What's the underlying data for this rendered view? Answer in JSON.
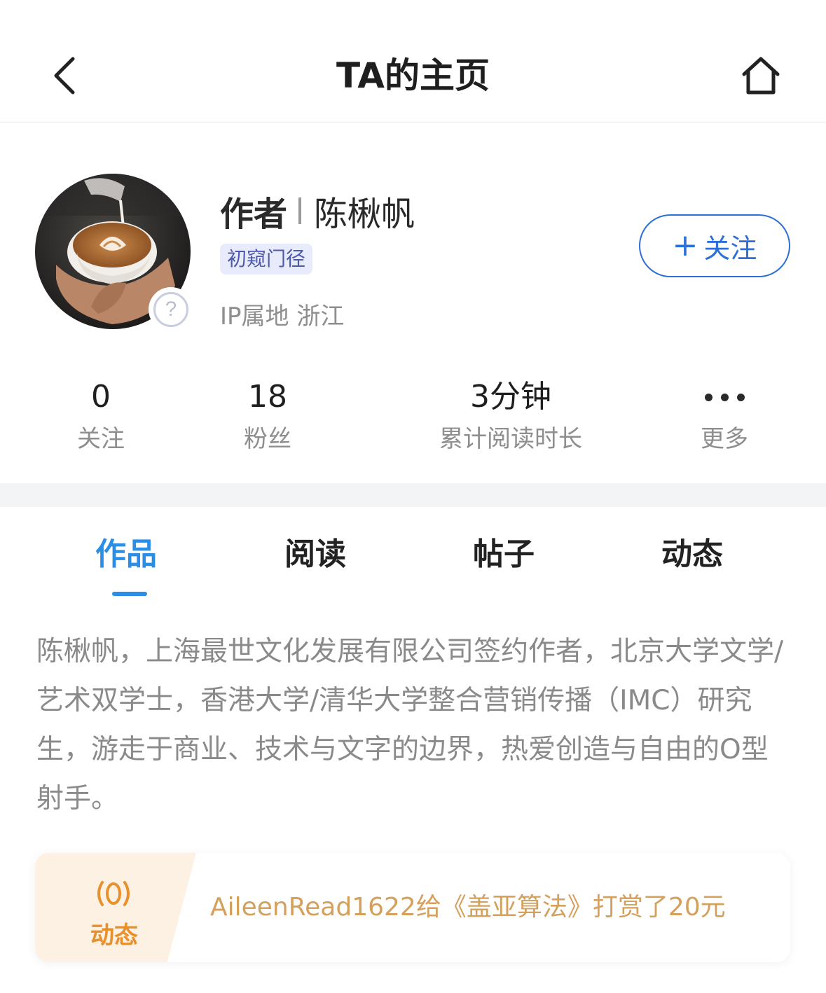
{
  "nav": {
    "title": "TA的主页",
    "back_icon": "chevron-left-icon",
    "home_icon": "home-icon"
  },
  "profile": {
    "role": "作者",
    "name": "陈楸帆",
    "level": "初窥门径",
    "ip_location": "IP属地 浙江",
    "avatar_badge": "?",
    "follow_button": {
      "plus": "+",
      "label": "关注"
    }
  },
  "stats": [
    {
      "value": "0",
      "label": "关注"
    },
    {
      "value": "18",
      "label": "粉丝"
    },
    {
      "value": "3分钟",
      "label": "累计阅读时长"
    }
  ],
  "more": {
    "label": "更多",
    "icon": "more-dots-icon"
  },
  "tabs": [
    {
      "label": "作品",
      "active": true
    },
    {
      "label": "阅读",
      "active": false
    },
    {
      "label": "帖子",
      "active": false
    },
    {
      "label": "动态",
      "active": false
    }
  ],
  "bio": "陈楸帆，上海最世文化发展有限公司签约作者，北京大学文学/艺术双学士，香港大学/清华大学整合营销传播（IMC）研究生，游走于商业、技术与文字的边界，热爱创造与自由的O型射手。",
  "activity": {
    "label": "动态",
    "icon": "broadcast-icon",
    "text": "AileenRead1622给《盖亚算法》打赏了20元"
  },
  "colors": {
    "accent_blue": "#2a8ee6",
    "follow_blue": "#2d6fd8",
    "activity_orange": "#e8902c",
    "activity_text": "#d4a05b",
    "level_bg": "#e8ebfb",
    "level_text": "#4e5aa8"
  }
}
